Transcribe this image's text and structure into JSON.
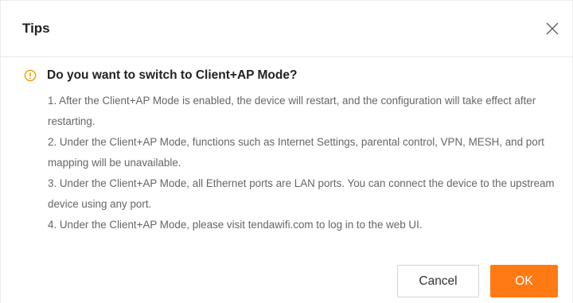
{
  "dialog": {
    "title": "Tips",
    "question": "Do you want to switch to Client+AP Mode?",
    "notes": [
      "1. After the Client+AP Mode is enabled, the device will restart, and the configuration will take effect after restarting.",
      "2. Under the Client+AP Mode, functions such as Internet Settings, parental control, VPN, MESH, and port mapping will be unavailable.",
      "3. Under the Client+AP Mode, all Ethernet ports are LAN ports. You can connect the device to the upstream device using any port.",
      "4. Under the Client+AP Mode, please visit tendawifi.com to log in to the web UI."
    ],
    "cancel_label": "Cancel",
    "ok_label": "OK"
  },
  "icons": {
    "close": "close-icon",
    "warning": "warning-icon"
  },
  "colors": {
    "accent": "#ff7a14",
    "warning": "#f39800",
    "text_primary": "#222222",
    "text_secondary": "#666666"
  }
}
